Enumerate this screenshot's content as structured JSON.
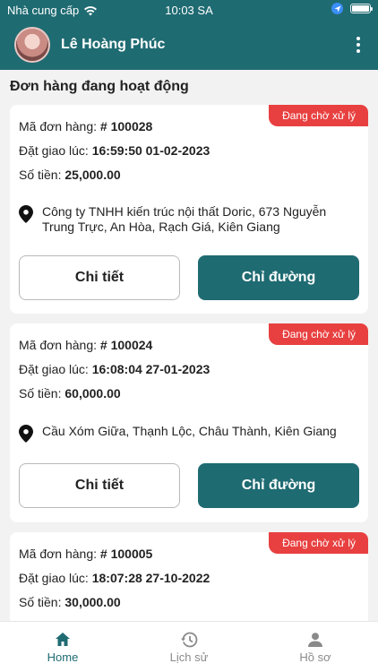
{
  "status_bar": {
    "carrier": "Nhà cung cấp",
    "time": "10:03 SA",
    "wifi_icon": "wifi-icon",
    "location_icon": "location-arrow-icon",
    "battery_icon": "battery-icon"
  },
  "header": {
    "user_name": "Lê Hoàng Phúc",
    "menu_icon": "more-vertical-icon",
    "background_color": "#1f6b72"
  },
  "section_title": "Đơn hàng đang hoạt động",
  "labels": {
    "order_id": "Mã đơn hàng: ",
    "delivery_time": "Đặt giao lúc: ",
    "amount": "Số tiền: ",
    "detail_button": "Chi tiết",
    "route_button": "Chỉ đường"
  },
  "orders": [
    {
      "status": "Đang chờ xử lý",
      "order_id": "# 100028",
      "delivery_time": "16:59:50 01-02-2023",
      "amount": "25,000.00",
      "address": "Công ty TNHH kiến trúc nội thất Doric, 673 Nguyễn Trung Trực, An Hòa, Rạch Giá, Kiên Giang"
    },
    {
      "status": "Đang chờ xử lý",
      "order_id": "# 100024",
      "delivery_time": "16:08:04 27-01-2023",
      "amount": "60,000.00",
      "address": "Cầu Xóm Giữa, Thạnh Lộc, Châu Thành, Kiên Giang"
    },
    {
      "status": "Đang chờ xử lý",
      "order_id": "# 100005",
      "delivery_time": "18:07:28 27-10-2022",
      "amount": "30,000.00"
    }
  ],
  "tabs": [
    {
      "label": "Home",
      "icon": "home-icon",
      "active": true
    },
    {
      "label": "Lịch sử",
      "icon": "history-icon",
      "active": false
    },
    {
      "label": "Hồ sơ",
      "icon": "profile-icon",
      "active": false
    }
  ],
  "colors": {
    "primary": "#1f6b72",
    "badge": "#e84040",
    "active_tab": "#1f6b72",
    "inactive_tab": "#8a8a8a"
  }
}
